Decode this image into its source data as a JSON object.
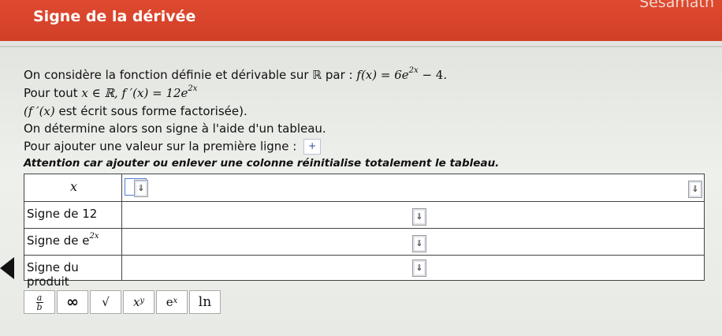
{
  "header": {
    "title": "Signe de la dérivée",
    "brand": "Sésamath"
  },
  "intro": {
    "line1_text": "On considère la fonction définie et dérivable sur ℝ par :",
    "line1_formula_prefix": "f(x) = 6e",
    "line1_formula_exp": "2x",
    "line1_formula_suffix": " − 4.",
    "line2_text": "Pour tout ",
    "line2_formula_prefix": "x ∈ ℝ, f ′(x) = 12e",
    "line2_formula_exp": "2x",
    "line3_formula": "(f ′(x)",
    "line3_text": " est écrit sous forme factorisée).",
    "line4_text": "On détermine alors son signe à l'aide d'un tableau.",
    "line5_text": "Pour ajouter une valeur sur la première ligne :",
    "add_button_label": "+",
    "note_text": "Attention car ajouter ou enlever une colonne réinitialise totalement le tableau."
  },
  "table": {
    "header_var": "x",
    "rows": [
      {
        "label": "Signe de 12",
        "exp": ""
      },
      {
        "label": "Signe de e",
        "exp": "2x"
      },
      {
        "label": "Signe du produit",
        "exp": ""
      }
    ],
    "dropdown_glyph": "⇓"
  },
  "toolbar": {
    "frac_num": "a",
    "frac_den": "b",
    "infinity": "∞",
    "sqrt": "√",
    "power_base": "x",
    "power_exp": "y",
    "exp_base": "e",
    "exp_exp": "x",
    "ln": "ln"
  }
}
